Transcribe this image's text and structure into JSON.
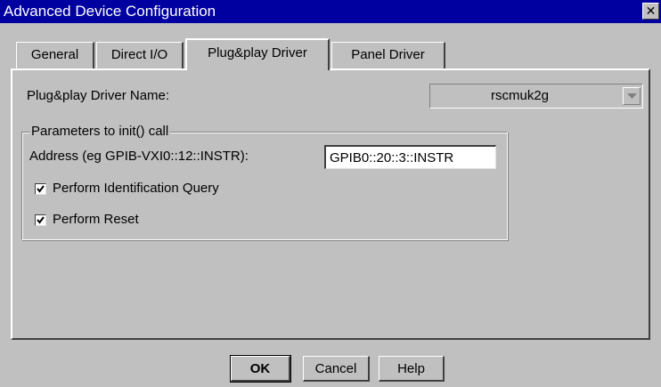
{
  "window": {
    "title": "Advanced Device Configuration",
    "close_glyph": "✕"
  },
  "tabs": [
    {
      "label": "General",
      "active": false
    },
    {
      "label": "Direct I/O",
      "active": false
    },
    {
      "label": "Plug&play Driver",
      "active": true
    },
    {
      "label": "Panel Driver",
      "active": false
    }
  ],
  "driver": {
    "name_label": "Plug&play Driver Name:",
    "name_value": "rscmuk2g"
  },
  "init_params": {
    "group_label": "Parameters to init() call",
    "address_label": "Address (eg GPIB-VXI0::12::INSTR):",
    "address_value": "GPIB0::20::3::INSTR",
    "identification_query": {
      "label": "Perform Identification Query",
      "checked": true
    },
    "reset": {
      "label": "Perform Reset",
      "checked": true
    }
  },
  "buttons": {
    "ok": "OK",
    "cancel": "Cancel",
    "help": "Help"
  },
  "icons": {
    "close": "close-icon",
    "dropdown": "chevron-down-icon",
    "check": "checkmark-icon"
  }
}
